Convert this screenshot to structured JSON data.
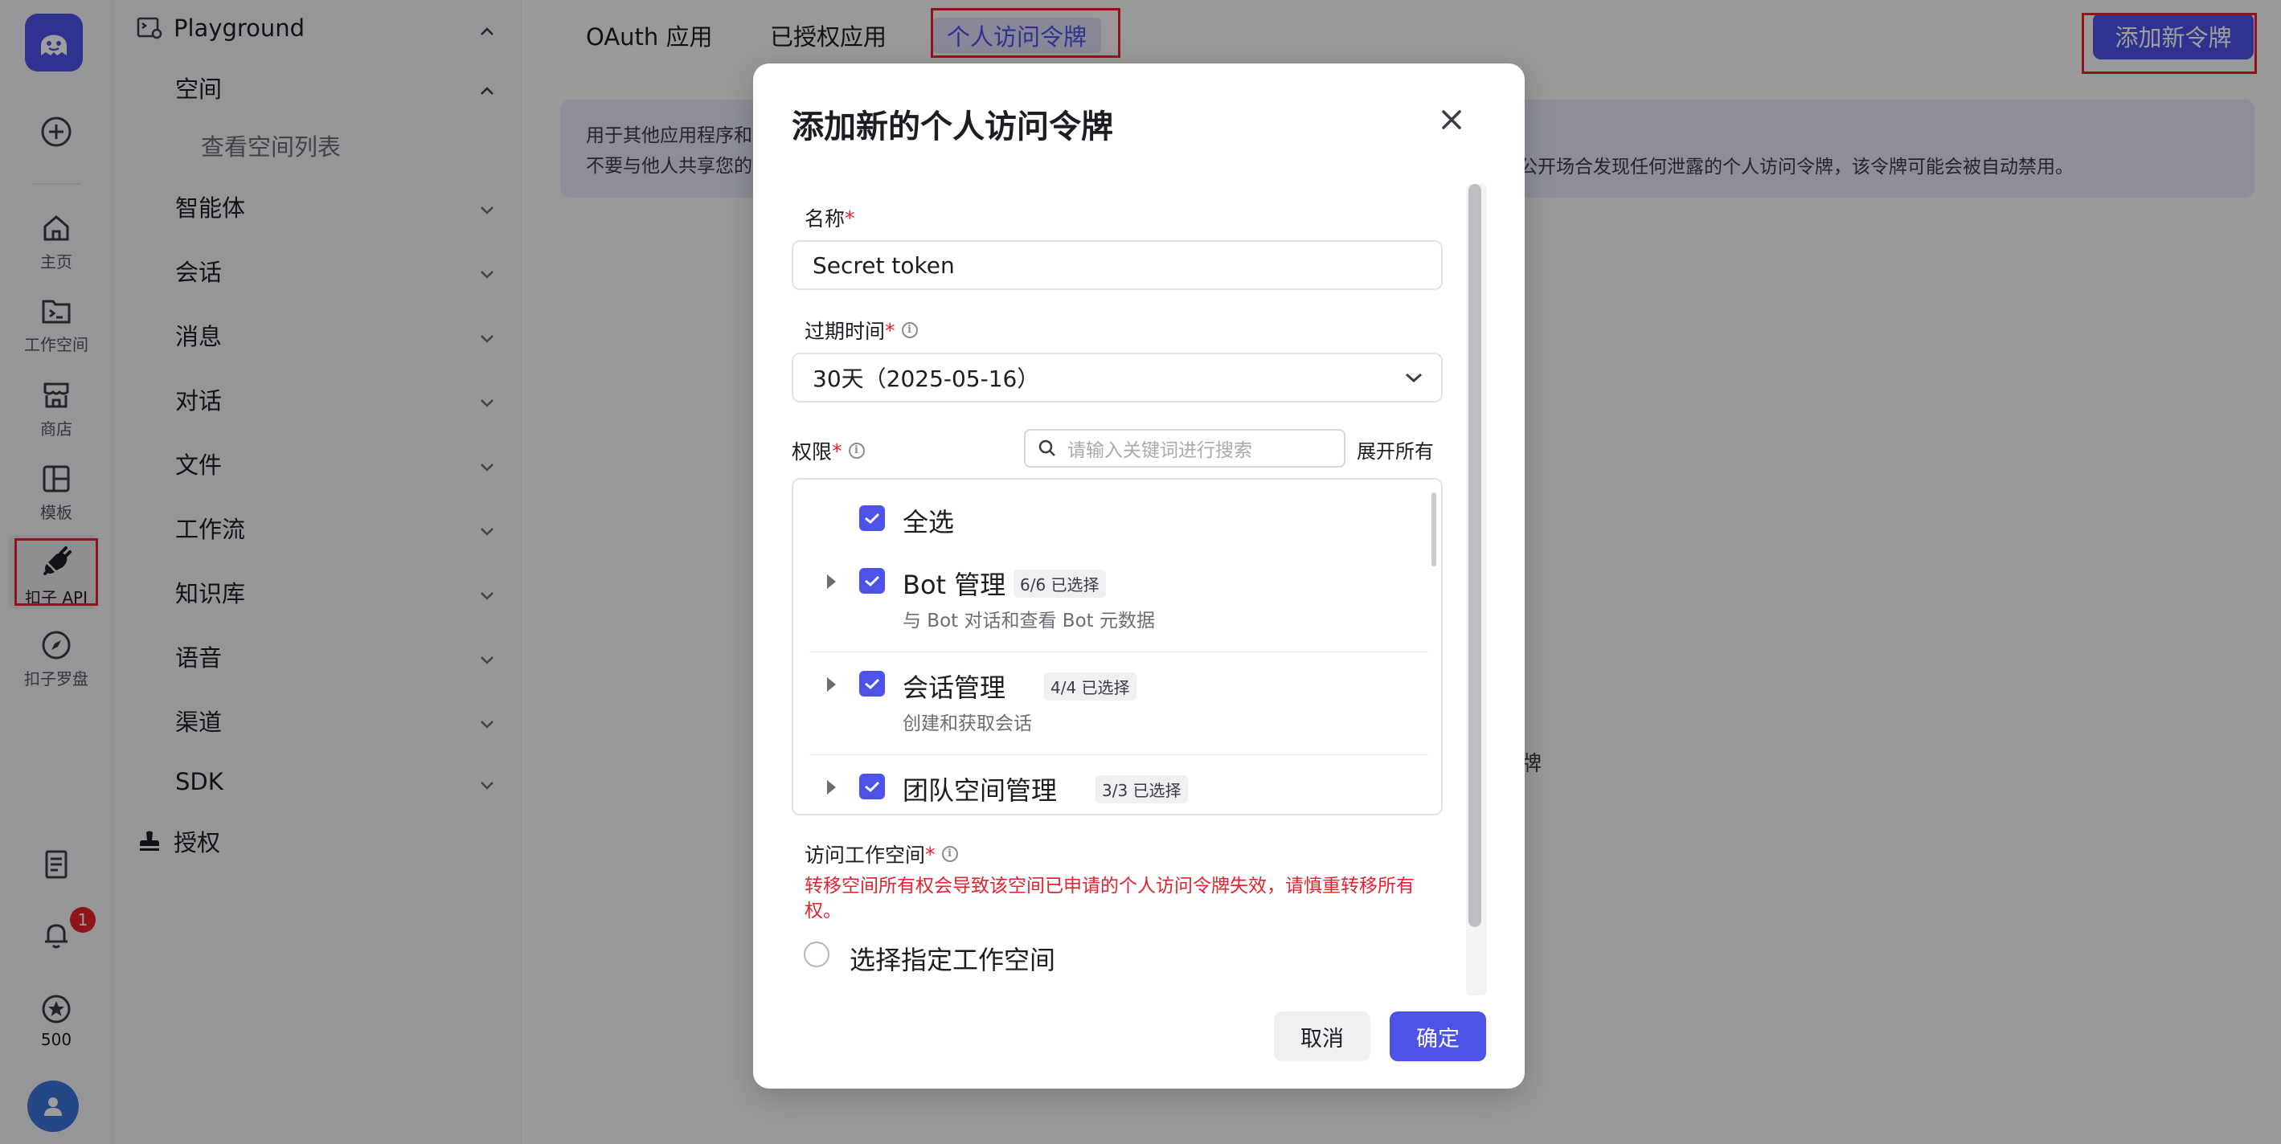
{
  "rail": {
    "items": [
      {
        "label": "",
        "icon": "plus-circle-icon"
      },
      {
        "label": "主页",
        "icon": "home-icon"
      },
      {
        "label": "工作空间",
        "icon": "terminal-folder-icon"
      },
      {
        "label": "商店",
        "icon": "store-icon"
      },
      {
        "label": "模板",
        "icon": "template-icon"
      },
      {
        "label": "扣子 API",
        "icon": "plug-icon"
      },
      {
        "label": "扣子罗盘",
        "icon": "compass-icon"
      }
    ],
    "notification_count": "1",
    "credits": "500"
  },
  "nav": {
    "playground": "Playground",
    "space": "空间",
    "space_list": "查看空间列表",
    "items": [
      "智能体",
      "会话",
      "消息",
      "对话",
      "文件",
      "工作流",
      "知识库",
      "语音",
      "渠道",
      "SDK"
    ],
    "auth": "授权"
  },
  "tabs": {
    "oauth": "OAuth 应用",
    "authorized": "已授权应用",
    "pat": "个人访问令牌"
  },
  "add_token_button": "添加新令牌",
  "info": {
    "line1": "用于其他应用程序和",
    "line2": "不要与他人共享您的",
    "line2_tail": "公开场合发现任何泄露的个人访问令牌，该令牌可能会被自动禁用。"
  },
  "empty_tail": "牌",
  "modal": {
    "title": "添加新的个人访问令牌",
    "name_label": "名称",
    "name_value": "Secret token",
    "expiry_label": "过期时间",
    "expiry_value": "30天（2025-05-16）",
    "permission_label": "权限",
    "search_placeholder": "请输入关键词进行搜索",
    "expand_all": "展开所有",
    "select_all": "全选",
    "permissions": [
      {
        "name": "Bot 管理",
        "count": "6/6 已选择",
        "desc": "与 Bot 对话和查看 Bot 元数据"
      },
      {
        "name": "会话管理",
        "count": "4/4 已选择",
        "desc": "创建和获取会话"
      },
      {
        "name": "团队空间管理",
        "count": "3/3 已选择",
        "desc": ""
      }
    ],
    "workspace_label": "访问工作空间",
    "warning": "转移空间所有权会导致该空间已申请的个人访问令牌失效，请慎重转移所有权。",
    "radio_option": "选择指定工作空间",
    "cancel": "取消",
    "confirm": "确定"
  },
  "colors": {
    "accent": "#4d53e8",
    "danger": "#e5222e"
  }
}
